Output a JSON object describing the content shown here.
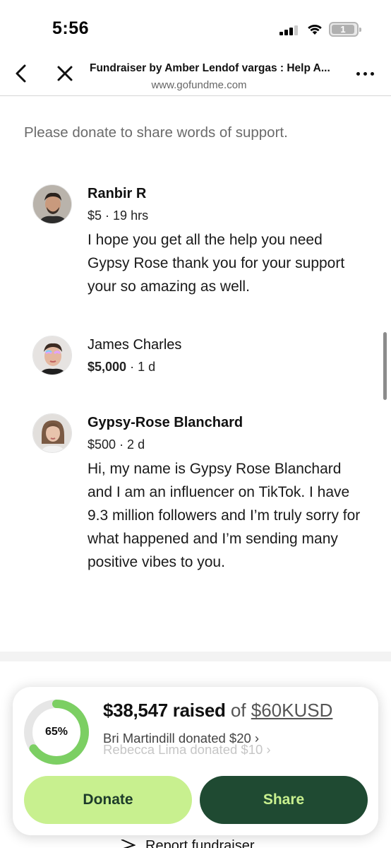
{
  "status_bar": {
    "time": "5:56",
    "battery_level": "1"
  },
  "browser": {
    "title": "Fundraiser by Amber Lendof vargas : Help A...",
    "url": "www.gofundme.com"
  },
  "content": {
    "prompt": "Please donate to share words of support.",
    "comments": [
      {
        "name": "Ranbir R",
        "amount": "$5",
        "time": "· 19 hrs",
        "text": "I hope you get all the help you need Gypsy Rose thank you for your sup­port your so amazing as well."
      },
      {
        "name": "James Charles",
        "amount": "$5,000",
        "time": "· 1 d",
        "text": ""
      },
      {
        "name": "Gypsy-Rose Blanchard",
        "amount": "$500",
        "time": "· 2 d",
        "text": "Hi, my name is Gypsy Rose Blanchard and I am an influencer on TikTok. I have 9.3 million followers and I’m truly sorry for what happened and I’m sending many positive vibes to you."
      }
    ]
  },
  "fundraiser_card": {
    "progress_percent": 65,
    "progress_label": "65%",
    "raised": "$38,547 raised",
    "of_text": " of ",
    "goal": "$60KUSD",
    "recent_donation": "Bri Martindill donated $20 ›",
    "previous_donation": "Rebecca Lima donated $10 ›",
    "donate_label": "Donate",
    "share_label": "Share",
    "colors": {
      "accent_green": "#c8f08f",
      "dark_green": "#1f4a32",
      "ring_track": "#e6e6e6"
    }
  },
  "footer": {
    "report_label": "Report fundraiser"
  }
}
